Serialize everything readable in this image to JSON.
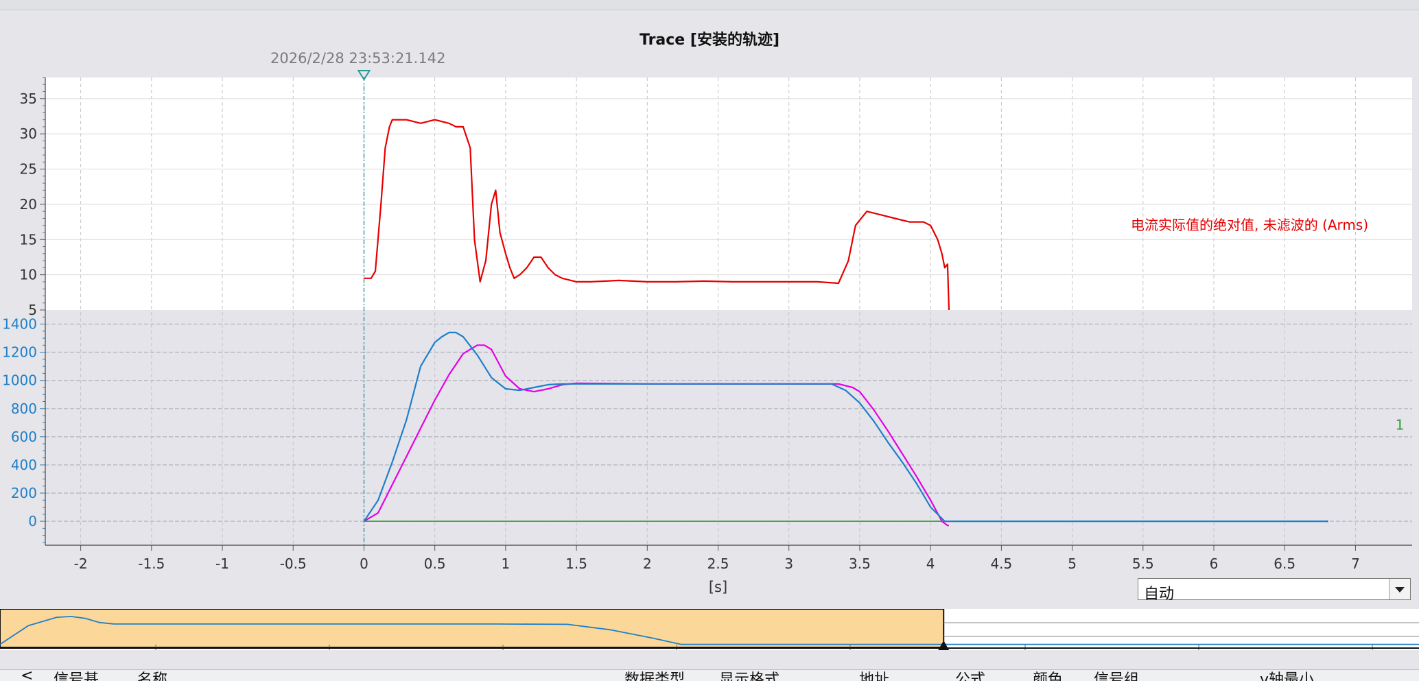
{
  "title": "Trace [安装的轨迹]",
  "trigger_timestamp": "2026/2/28 23:53:21.142",
  "mode_select": {
    "value": "自动"
  },
  "table_header": [
    "<",
    "信号基",
    "名称",
    "数据类型",
    "显示格式",
    "地址",
    "公式",
    "颜色",
    "信号组",
    "y轴最小"
  ],
  "colors": {
    "current": "#e60000",
    "blue": "#1f7fc8",
    "magenta": "#e600e6",
    "green": "#2e9e2e",
    "overview_fill": "#fcd79a"
  },
  "chart_data": {
    "type": "line",
    "title": "Trace [安装的轨迹]",
    "xlabel": "[s]",
    "xlim": [
      -2.25,
      7.4
    ],
    "xticks": [
      -2,
      -1.5,
      -1,
      -0.5,
      0,
      0.5,
      1,
      1.5,
      2,
      2.5,
      3,
      3.5,
      4,
      4.5,
      5,
      5.5,
      6,
      6.5,
      7
    ],
    "grid": true,
    "upper_axis": {
      "ylim": [
        5,
        38
      ],
      "yticks": [
        5,
        10,
        15,
        20,
        25,
        30,
        35
      ]
    },
    "lower_axis": {
      "ylim": [
        -170,
        1500
      ],
      "yticks": [
        0,
        200,
        400,
        600,
        800,
        1000,
        1200,
        1400
      ]
    },
    "lower_axis_marker": "1",
    "series": [
      {
        "name": "电流实际值的绝对值, 未滤波的 (Arms)",
        "axis": "upper",
        "x": [
          0,
          0.05,
          0.08,
          0.12,
          0.15,
          0.18,
          0.2,
          0.25,
          0.3,
          0.4,
          0.5,
          0.6,
          0.65,
          0.7,
          0.75,
          0.78,
          0.82,
          0.86,
          0.9,
          0.93,
          0.96,
          1.0,
          1.03,
          1.06,
          1.1,
          1.15,
          1.2,
          1.25,
          1.3,
          1.35,
          1.4,
          1.5,
          1.6,
          1.8,
          2.0,
          2.2,
          2.4,
          2.6,
          2.8,
          3.0,
          3.2,
          3.35,
          3.42,
          3.47,
          3.55,
          3.65,
          3.75,
          3.85,
          3.95,
          4.0,
          4.05,
          4.08,
          4.1,
          4.12,
          4.13
        ],
        "values": [
          9.5,
          9.5,
          10.5,
          20,
          28,
          31,
          32,
          32,
          32,
          31.5,
          32,
          31.5,
          31,
          31,
          28,
          15,
          9,
          12,
          20,
          22,
          16,
          13,
          11,
          9.5,
          10,
          11,
          12.5,
          12.5,
          11,
          10,
          9.5,
          9,
          9,
          9.2,
          9,
          9,
          9.1,
          9,
          9,
          9,
          9,
          8.8,
          12,
          17,
          19,
          18.5,
          18,
          17.5,
          17.5,
          17,
          15,
          13,
          11,
          11.5,
          5
        ]
      },
      {
        "name": "",
        "axis": "lower",
        "x": [
          0,
          0.1,
          0.2,
          0.3,
          0.4,
          0.5,
          0.55,
          0.6,
          0.65,
          0.7,
          0.8,
          0.9,
          1.0,
          1.1,
          1.2,
          1.3,
          1.4,
          1.5,
          2.0,
          2.5,
          3.0,
          3.3,
          3.4,
          3.5,
          3.6,
          3.7,
          3.8,
          3.9,
          4.0,
          4.1,
          5.0,
          6.0,
          6.8
        ],
        "values": [
          0,
          150,
          420,
          720,
          1100,
          1270,
          1310,
          1340,
          1340,
          1310,
          1180,
          1020,
          940,
          930,
          950,
          970,
          975,
          975,
          975,
          975,
          975,
          975,
          930,
          840,
          710,
          560,
          420,
          270,
          100,
          0,
          0,
          0,
          0
        ]
      },
      {
        "name": "",
        "axis": "lower",
        "x": [
          0,
          0.1,
          0.2,
          0.3,
          0.4,
          0.5,
          0.6,
          0.7,
          0.8,
          0.85,
          0.9,
          1.0,
          1.1,
          1.2,
          1.3,
          1.4,
          1.5,
          2.0,
          2.5,
          3.0,
          3.35,
          3.45,
          3.5,
          3.6,
          3.7,
          3.8,
          3.9,
          4.0,
          4.08,
          4.12,
          4.13
        ],
        "values": [
          0,
          60,
          260,
          460,
          660,
          860,
          1040,
          1190,
          1250,
          1250,
          1220,
          1030,
          940,
          920,
          940,
          970,
          980,
          975,
          975,
          975,
          975,
          950,
          920,
          790,
          640,
          480,
          320,
          150,
          0,
          -30,
          -30
        ]
      },
      {
        "name": "",
        "axis": "lower",
        "x": [
          0,
          4.13
        ],
        "values": [
          0,
          0
        ]
      }
    ]
  },
  "overview": {
    "x": [
      0,
      0.2,
      0.4,
      0.5,
      0.6,
      0.7,
      0.8,
      1.0,
      1.5,
      2.0,
      2.5,
      3.0,
      3.5,
      4.0,
      4.3,
      4.6,
      4.8,
      5.0,
      6.0,
      7.0,
      8.0,
      9.0,
      10.0
    ],
    "values": [
      0,
      900,
      1300,
      1340,
      1250,
      1050,
      980,
      975,
      975,
      975,
      975,
      975,
      975,
      960,
      700,
      300,
      0,
      0,
      0,
      0,
      0,
      0,
      0
    ],
    "xlim": [
      0,
      10
    ],
    "ylim": [
      -80,
      1500
    ],
    "window_end": 6.65
  }
}
